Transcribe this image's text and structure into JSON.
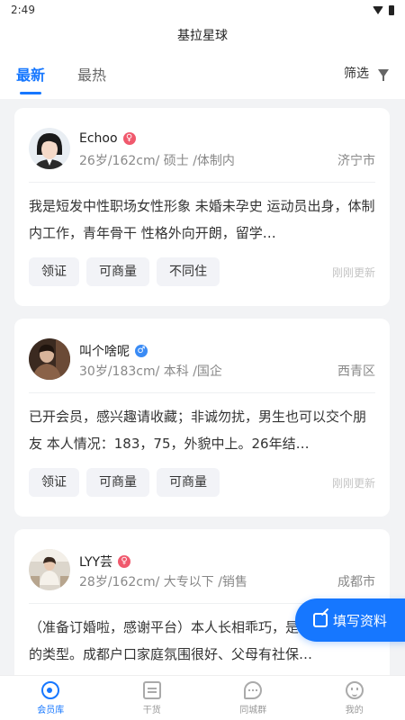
{
  "status_bar": {
    "time": "2:49"
  },
  "app": {
    "title": "基拉星球"
  },
  "tabs": [
    {
      "label": "最新",
      "active": true
    },
    {
      "label": "最热",
      "active": false
    }
  ],
  "filter": {
    "label": "筛选"
  },
  "cards": [
    {
      "name": "Echoo",
      "gender": "female",
      "gender_symbol": "♀",
      "meta": "26岁/162cm/ 硕士 /体制内",
      "city": "济宁市",
      "description": "我是短发中性职场女性形象 未婚未孕史 运动员出身，体制内工作，青年骨干 性格外向开朗，留学…",
      "tags": [
        "领证",
        "可商量",
        "不同住"
      ],
      "updated": "刚刚更新"
    },
    {
      "name": "叫个啥呢",
      "gender": "male",
      "gender_symbol": "♂",
      "meta": "30岁/183cm/ 本科 /国企",
      "city": "西青区",
      "description": "已开会员，感兴趣请收藏；非诚勿扰，男生也可以交个朋友 本人情况：183，75，外貌中上。26年结…",
      "tags": [
        "领证",
        "可商量",
        "可商量"
      ],
      "updated": "刚刚更新"
    },
    {
      "name": "LYY芸",
      "gender": "female",
      "gender_symbol": "♀",
      "meta": "28岁/162cm/ 大专以下 /销售",
      "city": "成都市",
      "description": "（准备订婚啦，感谢平台）本人长相乖巧，是大家都喜欢的类型。成都户口家庭氛围很好、父母有社保…",
      "tags": [],
      "updated": ""
    }
  ],
  "fab": {
    "label": "填写资料"
  },
  "bottom_nav": [
    {
      "label": "会员库",
      "active": true
    },
    {
      "label": "干货",
      "active": false
    },
    {
      "label": "同城群",
      "active": false
    },
    {
      "label": "我的",
      "active": false
    }
  ],
  "colors": {
    "accent": "#1677ff",
    "female": "#f0596d",
    "male": "#3a8bf5"
  }
}
